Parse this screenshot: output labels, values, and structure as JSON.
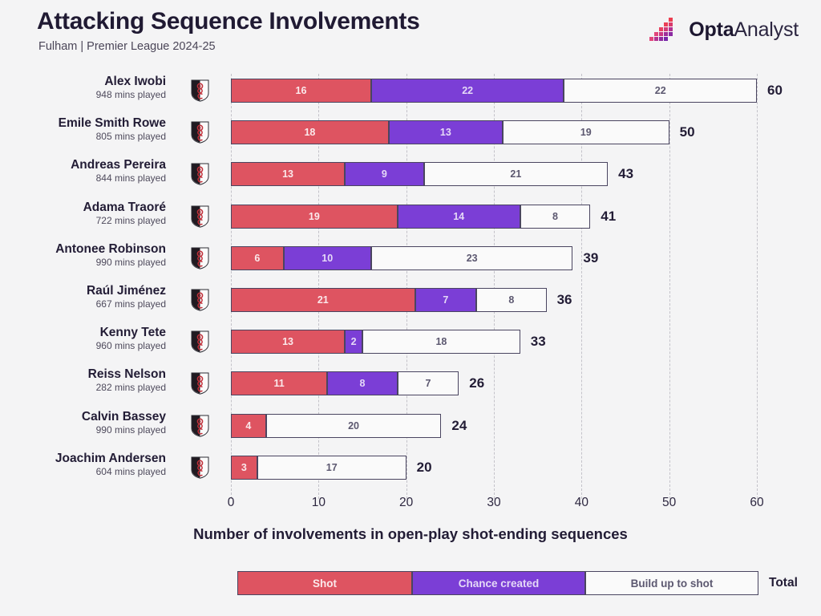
{
  "header": {
    "title": "Attacking Sequence Involvements",
    "subtitle": "Fulham | Premier League 2024-25",
    "logo_bold": "Opta",
    "logo_light": "Analyst"
  },
  "colors": {
    "shot": "#de5461",
    "chance_created": "#7b3ed6",
    "build_up": "#fafafa",
    "background": "#f4f4f5",
    "text": "#221c35"
  },
  "legend": {
    "items": [
      {
        "label": "Shot",
        "color": "#de5461"
      },
      {
        "label": "Chance created",
        "color": "#7b3ed6"
      },
      {
        "label": "Build up to shot",
        "color": "#fafafa"
      }
    ],
    "total_label": "Total"
  },
  "axis": {
    "title": "Number of involvements in open-play shot-ending sequences",
    "ticks": [
      0,
      10,
      20,
      30,
      40,
      50,
      60
    ]
  },
  "rows": [
    {
      "name": "Alex Iwobi",
      "mins": "948 mins played",
      "shot": 16,
      "chance": 22,
      "buildup": 22,
      "total": 60
    },
    {
      "name": "Emile Smith Rowe",
      "mins": "805 mins played",
      "shot": 18,
      "chance": 13,
      "buildup": 19,
      "total": 50
    },
    {
      "name": "Andreas Pereira",
      "mins": "844 mins played",
      "shot": 13,
      "chance": 9,
      "buildup": 21,
      "total": 43
    },
    {
      "name": "Adama Traoré",
      "mins": "722 mins played",
      "shot": 19,
      "chance": 14,
      "buildup": 8,
      "total": 41
    },
    {
      "name": "Antonee Robinson",
      "mins": "990 mins played",
      "shot": 6,
      "chance": 10,
      "buildup": 23,
      "total": 39
    },
    {
      "name": "Raúl Jiménez",
      "mins": "667 mins played",
      "shot": 21,
      "chance": 7,
      "buildup": 8,
      "total": 36
    },
    {
      "name": "Kenny Tete",
      "mins": "960 mins played",
      "shot": 13,
      "chance": 2,
      "buildup": 18,
      "total": 33
    },
    {
      "name": "Reiss Nelson",
      "mins": "282 mins played",
      "shot": 11,
      "chance": 8,
      "buildup": 7,
      "total": 26
    },
    {
      "name": "Calvin Bassey",
      "mins": "990 mins played",
      "shot": 4,
      "chance": 0,
      "buildup": 20,
      "total": 24
    },
    {
      "name": "Joachim Andersen",
      "mins": "604 mins played",
      "shot": 3,
      "chance": 0,
      "buildup": 17,
      "total": 20
    }
  ],
  "chart_data": {
    "type": "bar",
    "orientation": "horizontal",
    "stacked": true,
    "title": "Attacking Sequence Involvements",
    "subtitle": "Fulham | Premier League 2024-25",
    "xlabel": "Number of involvements in open-play shot-ending sequences",
    "ylabel": "",
    "xlim": [
      0,
      60
    ],
    "xticks": [
      0,
      10,
      20,
      30,
      40,
      50,
      60
    ],
    "grid": "vertical-dashed",
    "legend_position": "bottom",
    "categories": [
      "Alex Iwobi",
      "Emile Smith Rowe",
      "Andreas Pereira",
      "Adama Traoré",
      "Antonee Robinson",
      "Raúl Jiménez",
      "Kenny Tete",
      "Reiss Nelson",
      "Calvin Bassey",
      "Joachim Andersen"
    ],
    "category_sublabels": [
      "948 mins played",
      "805 mins played",
      "844 mins played",
      "722 mins played",
      "990 mins played",
      "667 mins played",
      "960 mins played",
      "282 mins played",
      "990 mins played",
      "604 mins played"
    ],
    "series": [
      {
        "name": "Shot",
        "color": "#de5461",
        "values": [
          16,
          18,
          13,
          19,
          6,
          21,
          13,
          11,
          4,
          3
        ]
      },
      {
        "name": "Chance created",
        "color": "#7b3ed6",
        "values": [
          22,
          13,
          9,
          14,
          10,
          7,
          2,
          8,
          0,
          0
        ]
      },
      {
        "name": "Build up to shot",
        "color": "#fafafa",
        "values": [
          22,
          19,
          21,
          8,
          23,
          8,
          18,
          7,
          20,
          17
        ]
      }
    ],
    "totals": [
      60,
      50,
      43,
      41,
      39,
      36,
      33,
      26,
      24,
      20
    ]
  }
}
